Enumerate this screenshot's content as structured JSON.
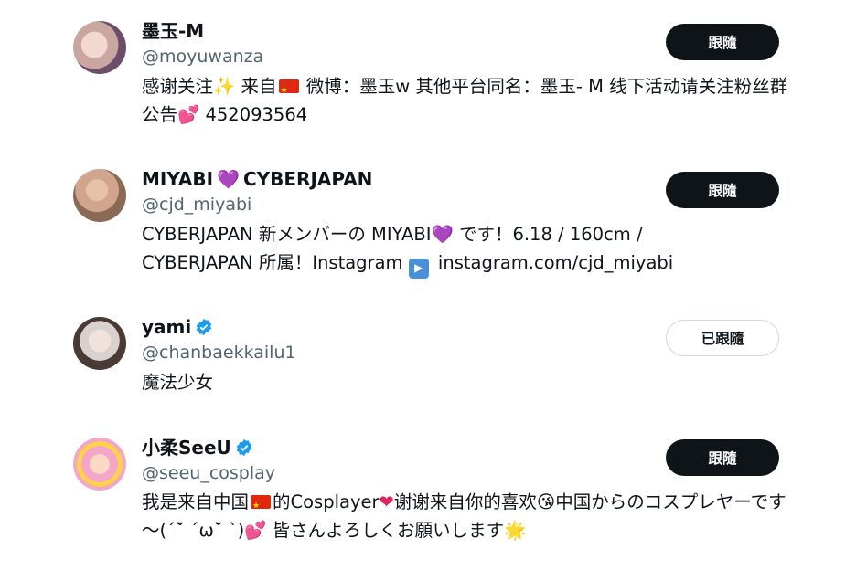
{
  "users": [
    {
      "name": "墨玉-M",
      "handle": "@moyuwanza",
      "bio_parts": [
        "感谢关注",
        "✨",
        " 来自",
        "",
        " 微博：墨玉w 其他平台同名：墨玉- M 线下活动请关注粉丝群公告",
        "💕",
        " 452093564"
      ],
      "button_label": "跟隨",
      "verified": false,
      "avatar_colors": [
        "#c9a6a0",
        "#6d4d6a"
      ]
    },
    {
      "name_parts": [
        "MIYABI",
        "💜",
        "CYBERJAPAN"
      ],
      "handle": "@cjd_miyabi",
      "bio_parts": [
        "CYBERJAPAN 新メンバーの MIYABI",
        "💜",
        " です！6.18 / 160cm / CYBERJAPAN 所属！Instagram ",
        "▶",
        " instagram.com/cjd_miyabi"
      ],
      "button_label": "跟隨",
      "verified": false,
      "avatar_colors": [
        "#8a6a55",
        "#d1a58d"
      ]
    },
    {
      "name": "yami",
      "handle": "@chanbaekkailu1",
      "bio_parts": [
        "魔法少女"
      ],
      "button_label": "已跟隨",
      "verified": true,
      "avatar_colors": [
        "#d8d1cf",
        "#4a3a36"
      ]
    },
    {
      "name": "小柔SeeU",
      "handle": "@seeu_cosplay",
      "bio_parts": [
        "我是来自中国",
        "",
        "的Cosplayer",
        "❤",
        "谢谢来自你的喜欢",
        "😘",
        "中国からのコスプレヤーです～(ˊ˘̀ ˊω˘̀ ˋ)",
        "💕",
        " 皆さんよろしくお願いします",
        "🌟"
      ],
      "button_label": "跟隨",
      "verified": true,
      "avatar_colors": [
        "#f3a6c8",
        "#ffd24a"
      ]
    }
  ],
  "colors": {
    "follow_bg": "#0f1419",
    "follow_text": "#ffffff",
    "handle": "#536471",
    "verified": "#1d9bf0"
  }
}
